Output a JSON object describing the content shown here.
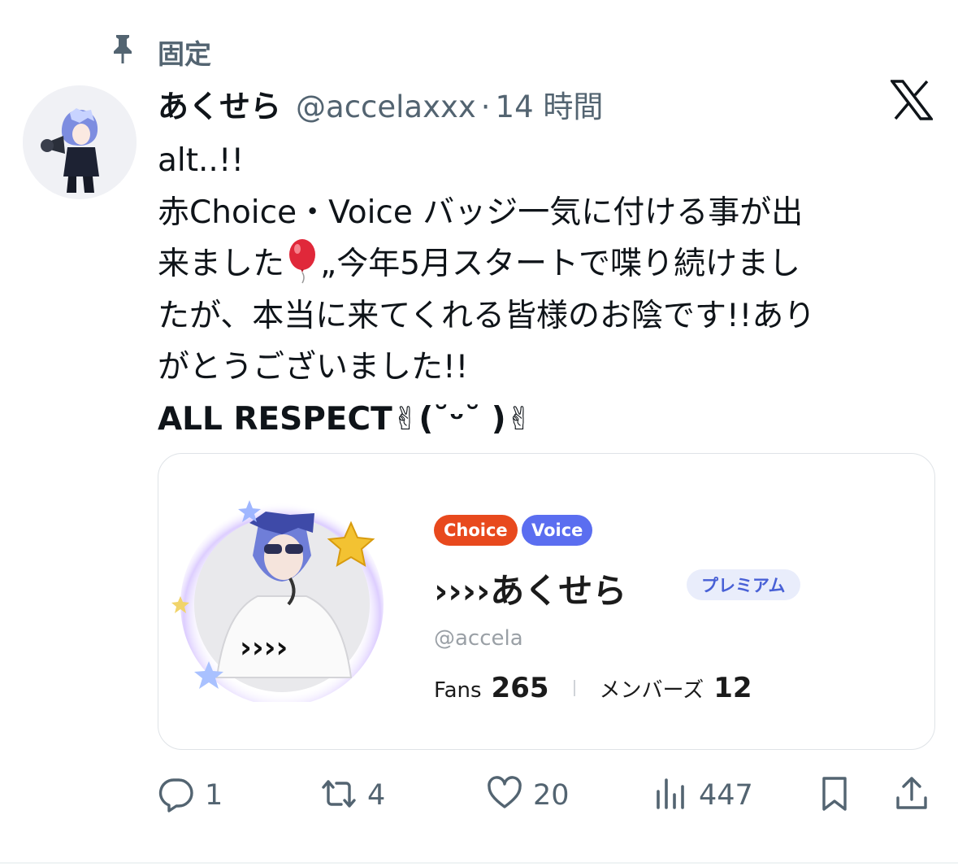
{
  "pinned": {
    "label": "固定",
    "icon": "pin-icon"
  },
  "post": {
    "author_name": "あくせら",
    "author_handle": "@accelaxxx",
    "separator": "·",
    "time": "14 時間",
    "platform_icon": "x-logo-icon",
    "lines": [
      "alt..!!",
      "赤Choice・Voice バッジ一気に付ける事が出",
      "来ました",
      "„今年5月スタートで喋り続けまし",
      "たが、本当に来てくれる皆様のお陰です!!あり",
      "がとうございました!!",
      "ALL RESPECT✌︎(˘ᵕ˘ )✌︎"
    ]
  },
  "card": {
    "badges": [
      "Choice",
      "Voice"
    ],
    "name": "››››あくせら",
    "tag": "プレミアム",
    "handle": "@accela",
    "fans_label": "Fans",
    "fans_value": "265",
    "members_label": "メンバーズ",
    "members_value": "12",
    "art_text": "››››"
  },
  "actions": {
    "reply_count": "1",
    "repost_count": "4",
    "like_count": "20",
    "views_count": "447"
  },
  "colors": {
    "text_primary": "#0f1419",
    "text_secondary": "#536471",
    "choice_badge": "#e8491d",
    "voice_badge": "#5b6ef0",
    "premium_bg": "#e9edfb",
    "premium_text": "#4860d6"
  }
}
